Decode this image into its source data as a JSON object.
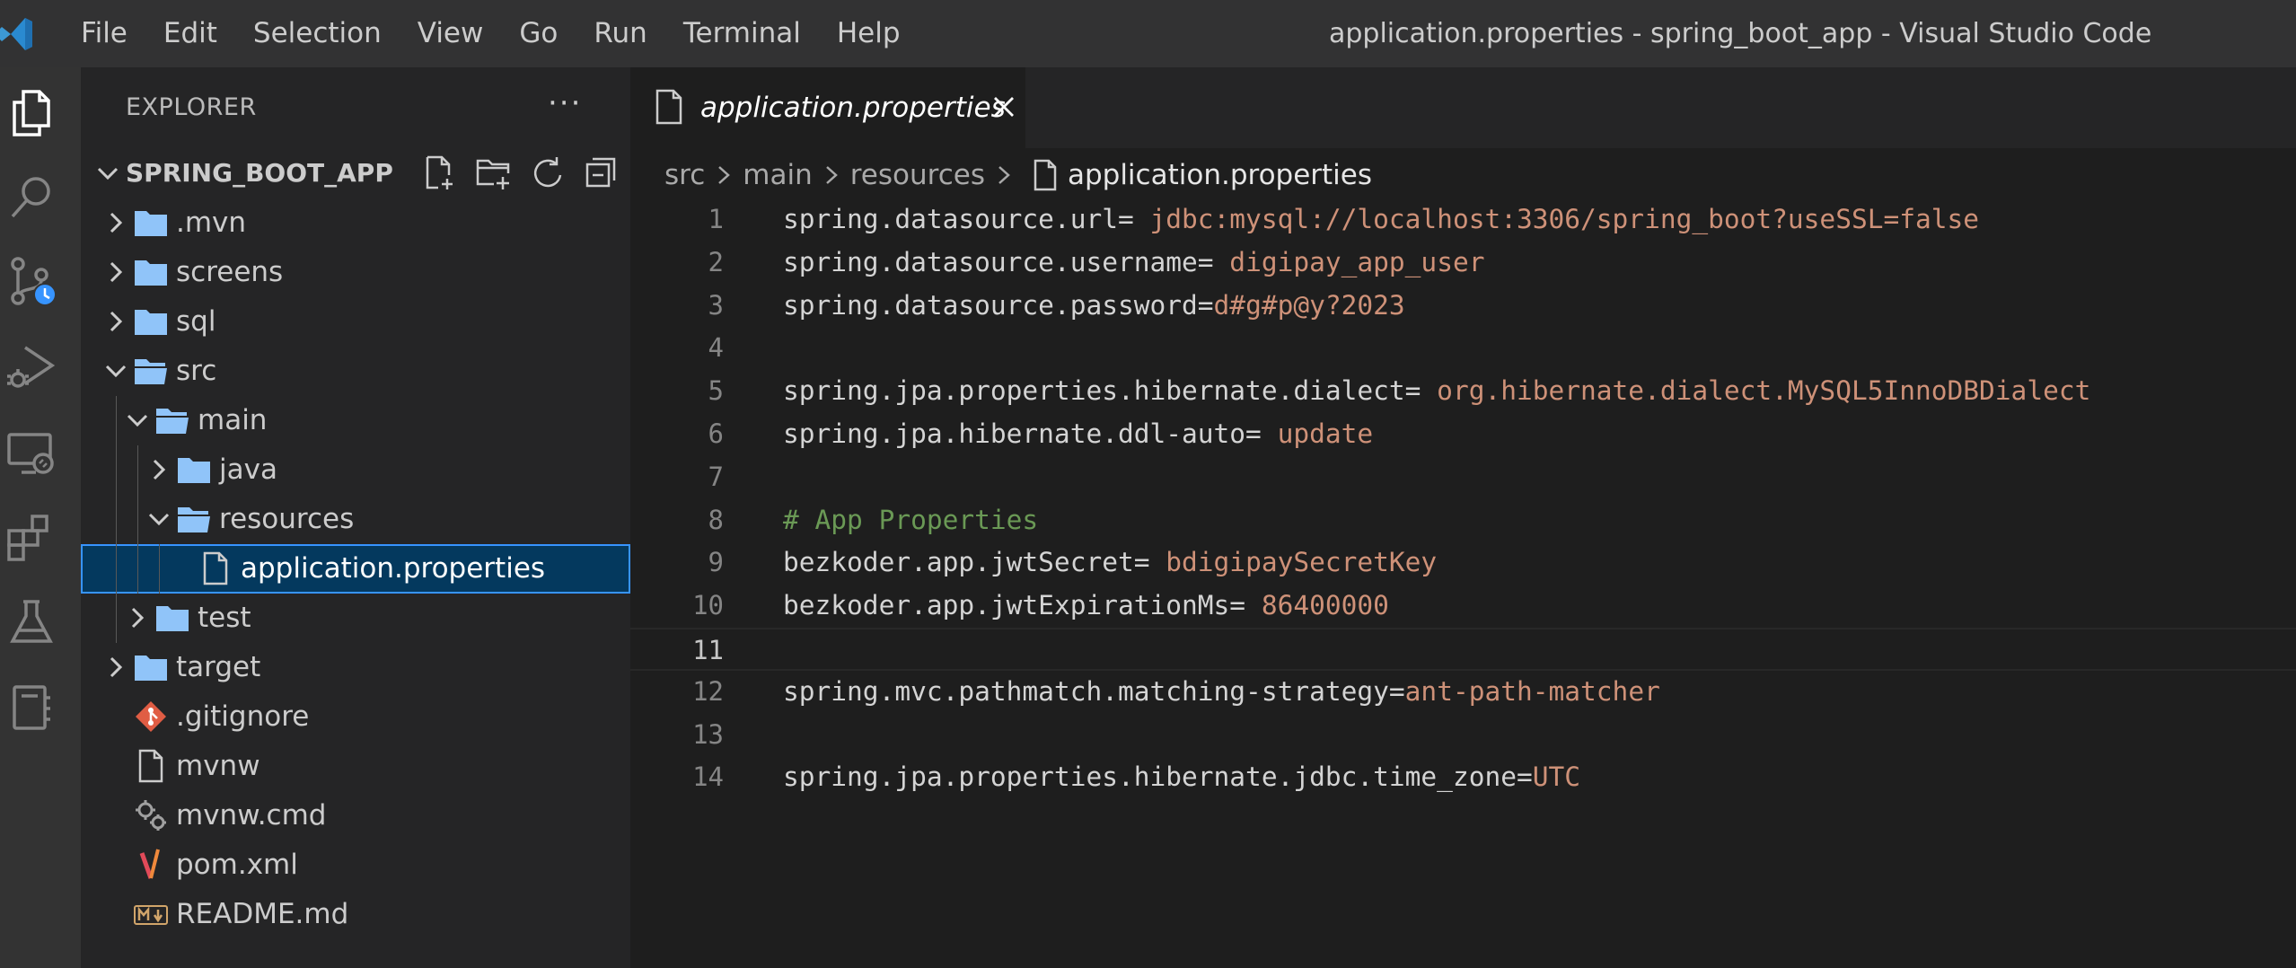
{
  "menu": [
    "File",
    "Edit",
    "Selection",
    "View",
    "Go",
    "Run",
    "Terminal",
    "Help"
  ],
  "window_title": "application.properties - spring_boot_app - Visual Studio Code",
  "activity_bar": [
    "explorer-icon",
    "search-icon",
    "source-control-icon",
    "run-debug-icon",
    "remote-explorer-icon",
    "extensions-icon",
    "testing-icon",
    "notebook-icon"
  ],
  "explorer": {
    "title": "EXPLORER",
    "more": "···",
    "folder": "SPRING_BOOT_APP",
    "tree": [
      {
        "label": ".mvn",
        "type": "folder",
        "expanded": false,
        "depth": 0
      },
      {
        "label": "screens",
        "type": "folder",
        "expanded": false,
        "depth": 0
      },
      {
        "label": "sql",
        "type": "folder",
        "expanded": false,
        "depth": 0
      },
      {
        "label": "src",
        "type": "folder",
        "expanded": true,
        "depth": 0
      },
      {
        "label": "main",
        "type": "folder",
        "expanded": true,
        "depth": 1
      },
      {
        "label": "java",
        "type": "folder",
        "expanded": false,
        "depth": 2
      },
      {
        "label": "resources",
        "type": "folder",
        "expanded": true,
        "depth": 2
      },
      {
        "label": "application.properties",
        "type": "file",
        "depth": 3,
        "selected": true
      },
      {
        "label": "test",
        "type": "folder",
        "expanded": false,
        "depth": 1
      },
      {
        "label": "target",
        "type": "folder",
        "expanded": false,
        "depth": 0
      },
      {
        "label": ".gitignore",
        "type": "git",
        "depth": 0
      },
      {
        "label": "mvnw",
        "type": "file",
        "depth": 0
      },
      {
        "label": "mvnw.cmd",
        "type": "gear",
        "depth": 0
      },
      {
        "label": "pom.xml",
        "type": "maven",
        "depth": 0
      },
      {
        "label": "README.md",
        "type": "markdown",
        "depth": 0
      }
    ]
  },
  "editor": {
    "tab_label": "application.properties",
    "breadcrumb": [
      "src",
      "main",
      "resources"
    ],
    "breadcrumb_file": "application.properties",
    "current_line": 11,
    "lines": [
      {
        "n": "1",
        "key": "spring.datasource.url=",
        "val": " jdbc:mysql://localhost:3306/spring_boot?useSSL=false"
      },
      {
        "n": "2",
        "key": "spring.datasource.username=",
        "val": " digipay_app_user"
      },
      {
        "n": "3",
        "key": "spring.datasource.password=",
        "val": "d#g#p@y?2023"
      },
      {
        "n": "4",
        "key": "",
        "val": ""
      },
      {
        "n": "5",
        "key": "spring.jpa.properties.hibernate.dialect=",
        "val": " org.hibernate.dialect.MySQL5InnoDBDialect"
      },
      {
        "n": "6",
        "key": "spring.jpa.hibernate.ddl-auto=",
        "val": " update"
      },
      {
        "n": "7",
        "key": "",
        "val": ""
      },
      {
        "n": "8",
        "comment": "# App Properties"
      },
      {
        "n": "9",
        "key": "bezkoder.app.jwtSecret=",
        "val": " bdigipaySecretKey"
      },
      {
        "n": "10",
        "key": "bezkoder.app.jwtExpirationMs=",
        "val": " 86400000"
      },
      {
        "n": "11",
        "key": "",
        "val": ""
      },
      {
        "n": "12",
        "key": "spring.mvc.pathmatch.matching-strategy=",
        "val": "ant-path-matcher"
      },
      {
        "n": "13",
        "key": "",
        "val": ""
      },
      {
        "n": "14",
        "key": "spring.jpa.properties.hibernate.jdbc.time_zone=",
        "val": "UTC"
      }
    ]
  },
  "colors": {
    "accent": "#3794ff",
    "folder": "#90c4f9",
    "string": "#ce9178",
    "comment": "#6a9955"
  }
}
